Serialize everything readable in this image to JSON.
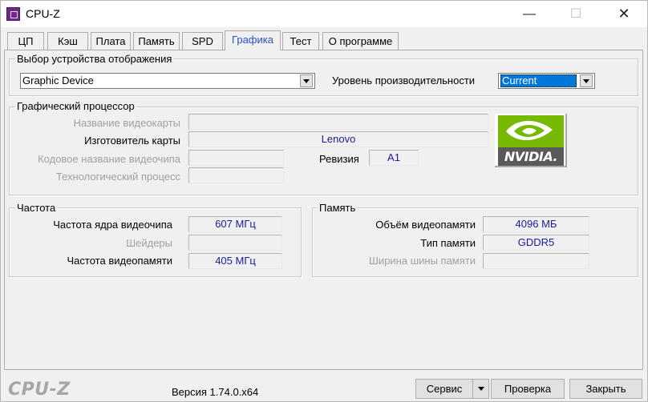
{
  "window": {
    "title": "CPU-Z",
    "minimize_glyph": "—",
    "maximize_glyph": "☐",
    "close_glyph": "✕"
  },
  "tabs": [
    {
      "label": "ЦП"
    },
    {
      "label": "Кэш"
    },
    {
      "label": "Плата"
    },
    {
      "label": "Память"
    },
    {
      "label": "SPD"
    },
    {
      "label": "Графика",
      "active": true
    },
    {
      "label": "Тест"
    },
    {
      "label": "О программе"
    }
  ],
  "display_select": {
    "title": "Выбор устройства отображения",
    "device_value": "Graphic Device",
    "perf_label": "Уровень производительности",
    "perf_value": "Current"
  },
  "gpu": {
    "title": "Графический процессор",
    "name_label": "Название видеокарты",
    "name_value": "",
    "vendor_label": "Изготовитель карты",
    "vendor_value": "Lenovo",
    "codename_label": "Кодовое название видеочипа",
    "codename_value": "",
    "revision_label": "Ревизия",
    "revision_value": "A1",
    "tech_label": "Технологический процесс",
    "tech_value": "",
    "logo_text": "NVIDIA."
  },
  "clocks": {
    "title": "Частота",
    "core_label": "Частота ядра видеочипа",
    "core_value": "607 МГц",
    "shaders_label": "Шейдеры",
    "shaders_value": "",
    "memory_label": "Частота видеопамяти",
    "memory_value": "405 МГц"
  },
  "memory": {
    "title": "Память",
    "size_label": "Объём видеопамяти",
    "size_value": "4096 МБ",
    "type_label": "Тип памяти",
    "type_value": "GDDR5",
    "bus_label": "Ширина шины памяти",
    "bus_value": ""
  },
  "footer": {
    "brand": "CPU-Z",
    "version": "Версия 1.74.0.x64",
    "tools_label": "Сервис",
    "validate_label": "Проверка",
    "close_label": "Закрыть"
  },
  "colors": {
    "active_tab": "#2a4fd0",
    "value_text": "#1a1a9a",
    "selection": "#0078d7",
    "nvidia_green": "#76b900"
  }
}
